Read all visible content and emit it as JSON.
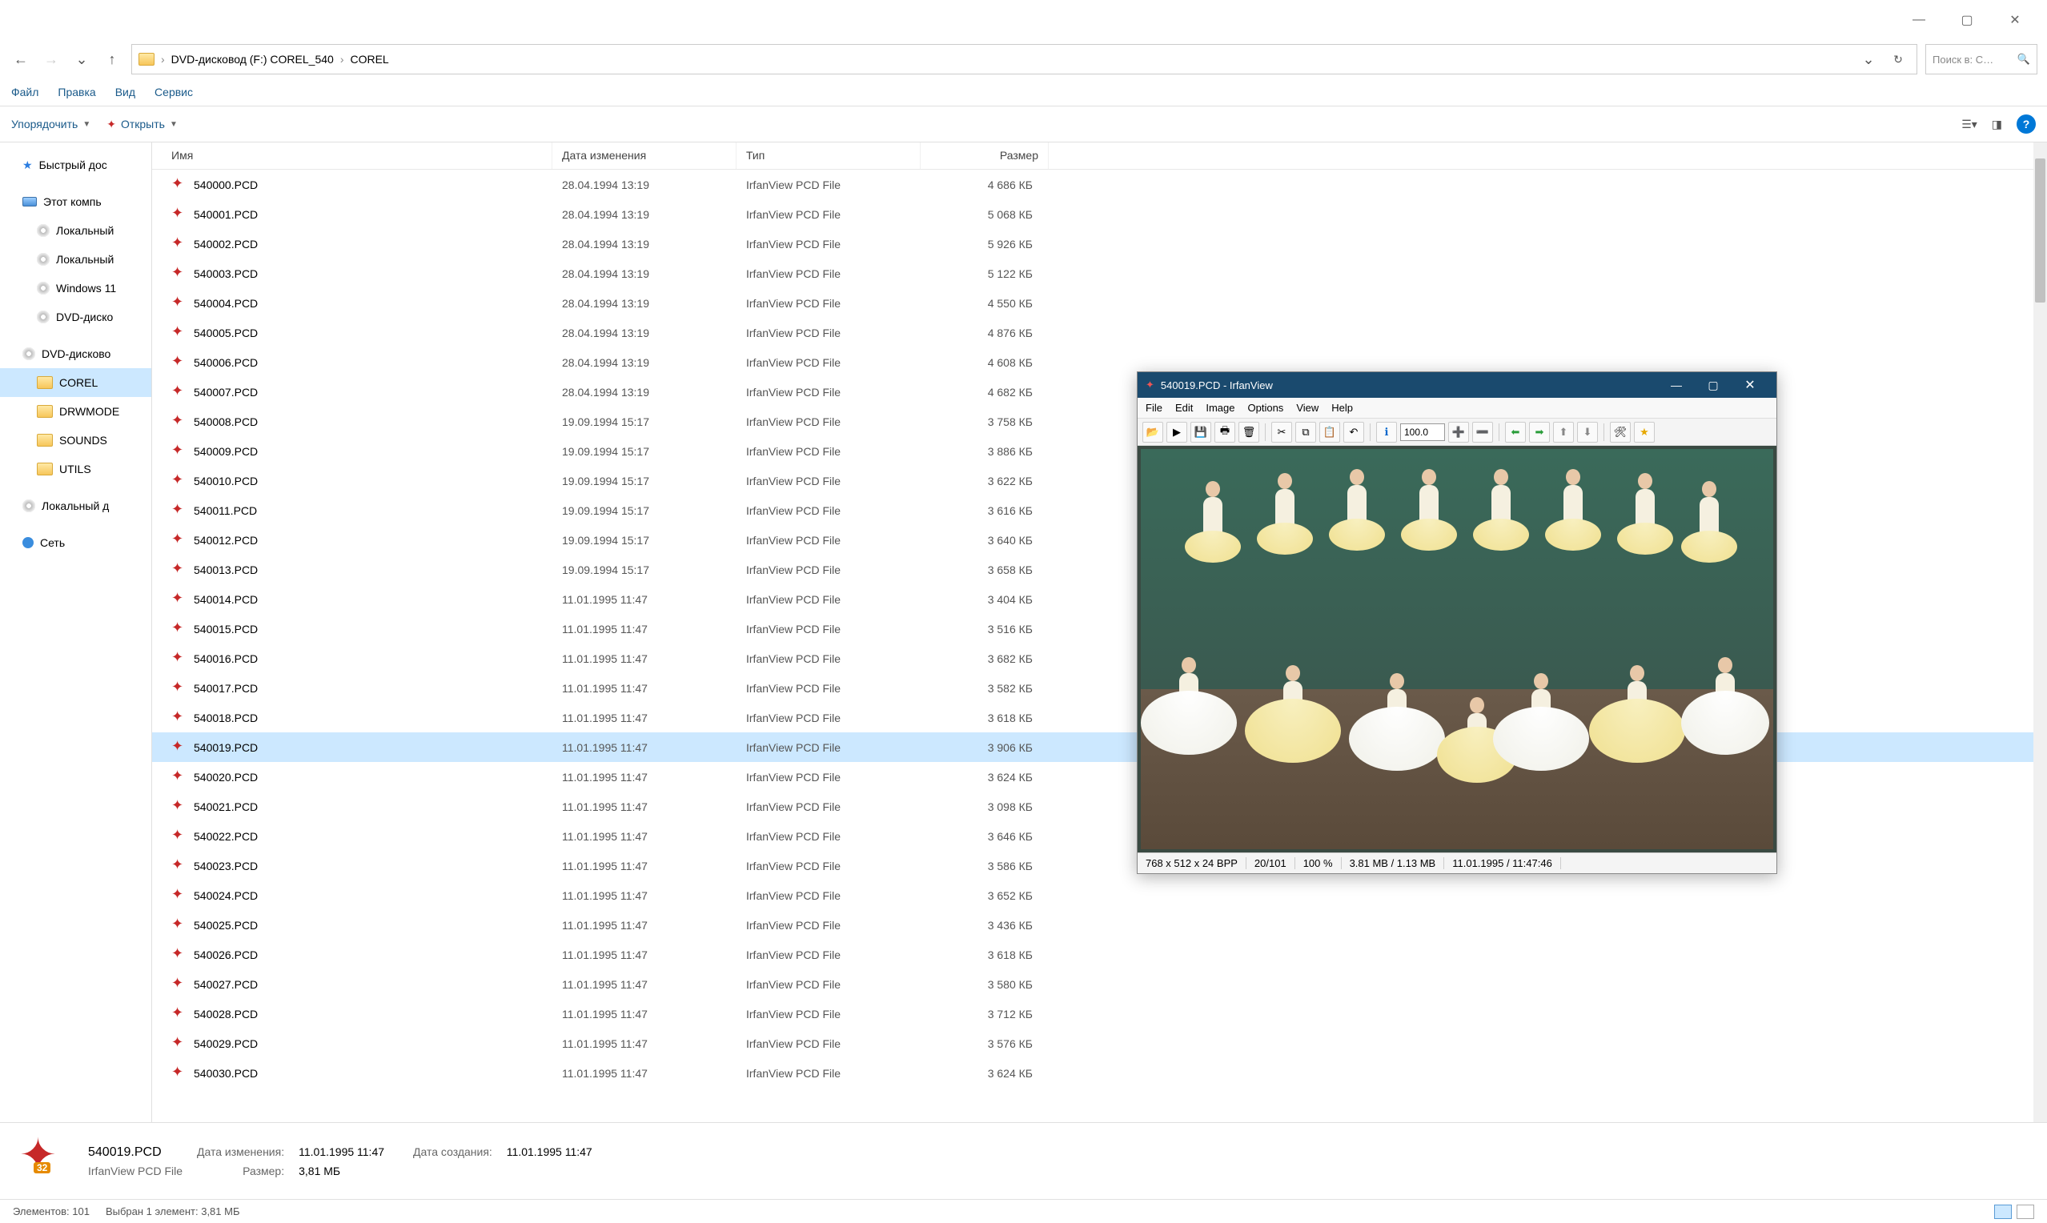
{
  "titlebar": {
    "minimize": "—",
    "maximize": "▢",
    "close": "✕"
  },
  "nav": {
    "back": "←",
    "forward": "→",
    "dropdown": "⌄",
    "up": "↑",
    "refresh": "↻",
    "crumbs": [
      "DVD-дисковод (F:) COREL_540",
      "COREL"
    ],
    "search_placeholder": "Поиск в: C…"
  },
  "menus": [
    "Файл",
    "Правка",
    "Вид",
    "Сервис"
  ],
  "toolbar": {
    "organize": "Упорядочить",
    "open": "Открыть",
    "help": "?"
  },
  "sidebar": {
    "items": [
      {
        "label": "Быстрый дос",
        "icon": "star"
      },
      {
        "label": "Этот компь",
        "icon": "pc"
      },
      {
        "label": "Локальный",
        "icon": "disc",
        "indent": true
      },
      {
        "label": "Локальный",
        "icon": "disc",
        "indent": true
      },
      {
        "label": "Windows 11",
        "icon": "disc",
        "indent": true
      },
      {
        "label": "DVD-диско",
        "icon": "disc",
        "indent": true
      },
      {
        "label": "DVD-дисково",
        "icon": "disc"
      },
      {
        "label": "COREL",
        "icon": "folder",
        "indent": true,
        "selected": true
      },
      {
        "label": "DRWMODE",
        "icon": "folder",
        "indent": true
      },
      {
        "label": "SOUNDS",
        "icon": "folder",
        "indent": true
      },
      {
        "label": "UTILS",
        "icon": "folder",
        "indent": true
      },
      {
        "label": "Локальный д",
        "icon": "disc"
      },
      {
        "label": "Сеть",
        "icon": "net"
      }
    ]
  },
  "columns": {
    "name": "Имя",
    "date": "Дата изменения",
    "type": "Тип",
    "size": "Размер"
  },
  "files": [
    {
      "name": "540000.PCD",
      "date": "28.04.1994 13:19",
      "type": "IrfanView PCD File",
      "size": "4 686 КБ"
    },
    {
      "name": "540001.PCD",
      "date": "28.04.1994 13:19",
      "type": "IrfanView PCD File",
      "size": "5 068 КБ"
    },
    {
      "name": "540002.PCD",
      "date": "28.04.1994 13:19",
      "type": "IrfanView PCD File",
      "size": "5 926 КБ"
    },
    {
      "name": "540003.PCD",
      "date": "28.04.1994 13:19",
      "type": "IrfanView PCD File",
      "size": "5 122 КБ"
    },
    {
      "name": "540004.PCD",
      "date": "28.04.1994 13:19",
      "type": "IrfanView PCD File",
      "size": "4 550 КБ"
    },
    {
      "name": "540005.PCD",
      "date": "28.04.1994 13:19",
      "type": "IrfanView PCD File",
      "size": "4 876 КБ"
    },
    {
      "name": "540006.PCD",
      "date": "28.04.1994 13:19",
      "type": "IrfanView PCD File",
      "size": "4 608 КБ"
    },
    {
      "name": "540007.PCD",
      "date": "28.04.1994 13:19",
      "type": "IrfanView PCD File",
      "size": "4 682 КБ"
    },
    {
      "name": "540008.PCD",
      "date": "19.09.1994 15:17",
      "type": "IrfanView PCD File",
      "size": "3 758 КБ"
    },
    {
      "name": "540009.PCD",
      "date": "19.09.1994 15:17",
      "type": "IrfanView PCD File",
      "size": "3 886 КБ"
    },
    {
      "name": "540010.PCD",
      "date": "19.09.1994 15:17",
      "type": "IrfanView PCD File",
      "size": "3 622 КБ"
    },
    {
      "name": "540011.PCD",
      "date": "19.09.1994 15:17",
      "type": "IrfanView PCD File",
      "size": "3 616 КБ"
    },
    {
      "name": "540012.PCD",
      "date": "19.09.1994 15:17",
      "type": "IrfanView PCD File",
      "size": "3 640 КБ"
    },
    {
      "name": "540013.PCD",
      "date": "19.09.1994 15:17",
      "type": "IrfanView PCD File",
      "size": "3 658 КБ"
    },
    {
      "name": "540014.PCD",
      "date": "11.01.1995 11:47",
      "type": "IrfanView PCD File",
      "size": "3 404 КБ"
    },
    {
      "name": "540015.PCD",
      "date": "11.01.1995 11:47",
      "type": "IrfanView PCD File",
      "size": "3 516 КБ"
    },
    {
      "name": "540016.PCD",
      "date": "11.01.1995 11:47",
      "type": "IrfanView PCD File",
      "size": "3 682 КБ"
    },
    {
      "name": "540017.PCD",
      "date": "11.01.1995 11:47",
      "type": "IrfanView PCD File",
      "size": "3 582 КБ"
    },
    {
      "name": "540018.PCD",
      "date": "11.01.1995 11:47",
      "type": "IrfanView PCD File",
      "size": "3 618 КБ"
    },
    {
      "name": "540019.PCD",
      "date": "11.01.1995 11:47",
      "type": "IrfanView PCD File",
      "size": "3 906 КБ",
      "selected": true
    },
    {
      "name": "540020.PCD",
      "date": "11.01.1995 11:47",
      "type": "IrfanView PCD File",
      "size": "3 624 КБ"
    },
    {
      "name": "540021.PCD",
      "date": "11.01.1995 11:47",
      "type": "IrfanView PCD File",
      "size": "3 098 КБ"
    },
    {
      "name": "540022.PCD",
      "date": "11.01.1995 11:47",
      "type": "IrfanView PCD File",
      "size": "3 646 КБ"
    },
    {
      "name": "540023.PCD",
      "date": "11.01.1995 11:47",
      "type": "IrfanView PCD File",
      "size": "3 586 КБ"
    },
    {
      "name": "540024.PCD",
      "date": "11.01.1995 11:47",
      "type": "IrfanView PCD File",
      "size": "3 652 КБ"
    },
    {
      "name": "540025.PCD",
      "date": "11.01.1995 11:47",
      "type": "IrfanView PCD File",
      "size": "3 436 КБ"
    },
    {
      "name": "540026.PCD",
      "date": "11.01.1995 11:47",
      "type": "IrfanView PCD File",
      "size": "3 618 КБ"
    },
    {
      "name": "540027.PCD",
      "date": "11.01.1995 11:47",
      "type": "IrfanView PCD File",
      "size": "3 580 КБ"
    },
    {
      "name": "540028.PCD",
      "date": "11.01.1995 11:47",
      "type": "IrfanView PCD File",
      "size": "3 712 КБ"
    },
    {
      "name": "540029.PCD",
      "date": "11.01.1995 11:47",
      "type": "IrfanView PCD File",
      "size": "3 576 КБ"
    },
    {
      "name": "540030.PCD",
      "date": "11.01.1995 11:47",
      "type": "IrfanView PCD File",
      "size": "3 624 КБ"
    }
  ],
  "details": {
    "badge": "32",
    "filename": "540019.PCD",
    "filetype": "IrfanView PCD File",
    "date_mod_label": "Дата изменения:",
    "date_mod_value": "11.01.1995 11:47",
    "date_created_label": "Дата создания:",
    "date_created_value": "11.01.1995 11:47",
    "size_label": "Размер:",
    "size_value": "3,81 МБ"
  },
  "status": {
    "elements_label": "Элементов:",
    "elements_count": "101",
    "selection": "Выбран 1 элемент: 3,81 МБ"
  },
  "irfan": {
    "title": "540019.PCD - IrfanView",
    "menus": [
      "File",
      "Edit",
      "Image",
      "Options",
      "View",
      "Help"
    ],
    "zoom": "100.0",
    "status": {
      "dims": "768 x 512 x 24 BPP",
      "index": "20/101",
      "zoom": "100 %",
      "mem": "3.81 MB / 1.13 MB",
      "datetime": "11.01.1995 / 11:47:46"
    }
  }
}
